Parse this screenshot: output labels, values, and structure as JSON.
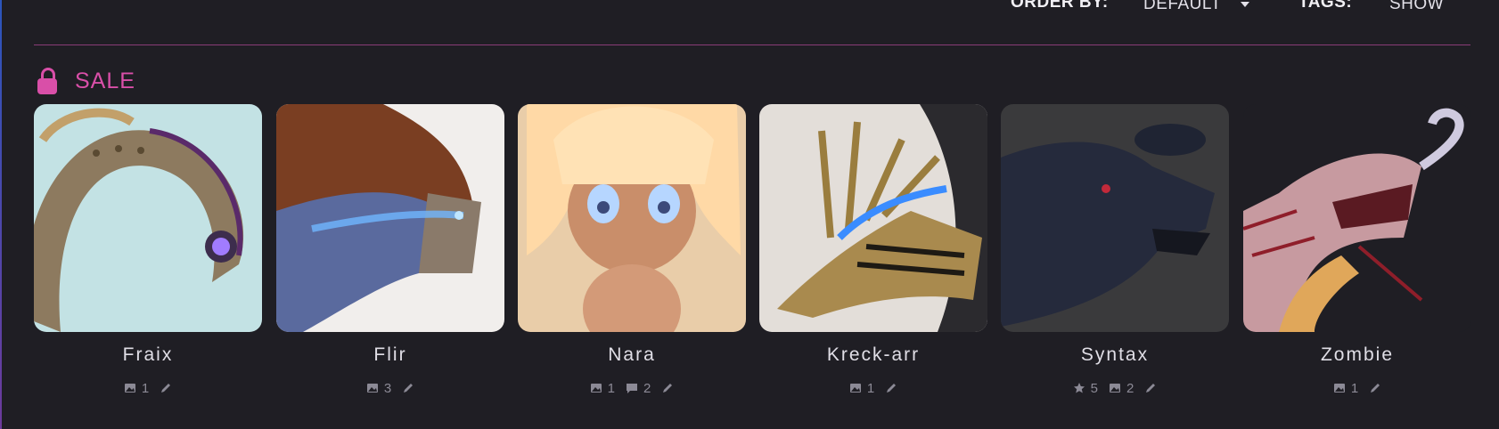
{
  "toolbar": {
    "order_label": "ORDER BY:",
    "order_value": "DEFAULT",
    "tags_label": "TAGS:",
    "tags_value": "SHOW"
  },
  "section": {
    "title": "SALE",
    "icon": "lock-icon"
  },
  "colors": {
    "background": "#1f1e24",
    "accent": "#d94fa8",
    "divider": "#8a3d78",
    "meta_text": "#8c8a96"
  },
  "cards": [
    {
      "name": "Fraix",
      "stats": [
        {
          "icon": "image-icon",
          "value": "1"
        }
      ]
    },
    {
      "name": "Flir",
      "stats": [
        {
          "icon": "image-icon",
          "value": "3"
        }
      ]
    },
    {
      "name": "Nara",
      "stats": [
        {
          "icon": "image-icon",
          "value": "1"
        },
        {
          "icon": "comment-icon",
          "value": "2"
        }
      ]
    },
    {
      "name": "Kreck-arr",
      "stats": [
        {
          "icon": "image-icon",
          "value": "1"
        }
      ]
    },
    {
      "name": "Syntax",
      "stats": [
        {
          "icon": "star-icon",
          "value": "5"
        },
        {
          "icon": "image-icon",
          "value": "2"
        }
      ]
    },
    {
      "name": "Zombie",
      "stats": [
        {
          "icon": "image-icon",
          "value": "1"
        }
      ]
    }
  ]
}
